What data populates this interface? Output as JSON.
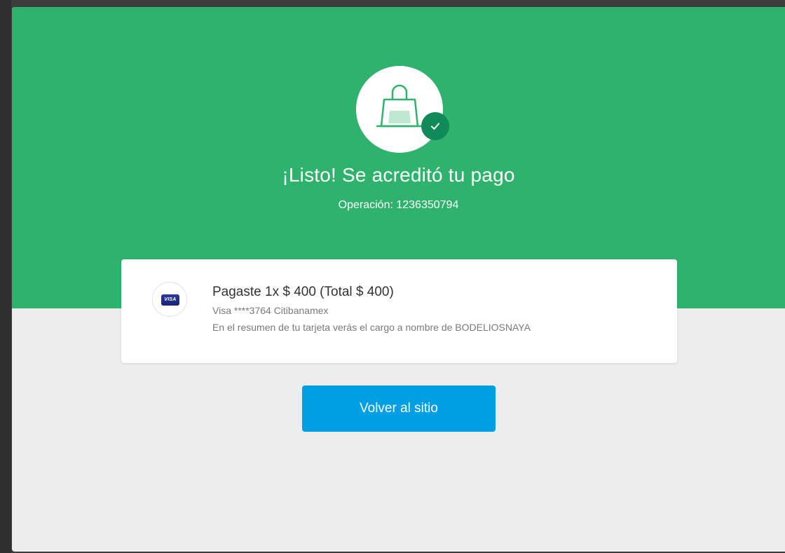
{
  "colors": {
    "hero_green": "#2fb26c",
    "badge_green": "#0f8a58",
    "button_blue": "#009ee3",
    "page_gray": "#ededed"
  },
  "hero": {
    "icon": "shopping-bag-icon",
    "badge_icon": "check-icon",
    "title": "¡Listo! Se acreditó tu pago",
    "operation": "Operación: 1236350794"
  },
  "payment": {
    "card_icon": "visa-card-icon",
    "card_brand_label": "VISA",
    "summary": "Pagaste 1x $ 400 (Total $ 400)",
    "card_info": "Visa ****3764 Citibanamex",
    "statement_note": "En el resumen de tu tarjeta verás el cargo a nombre de BODELIOSNAYA"
  },
  "actions": {
    "back_label": "Volver al sitio"
  }
}
